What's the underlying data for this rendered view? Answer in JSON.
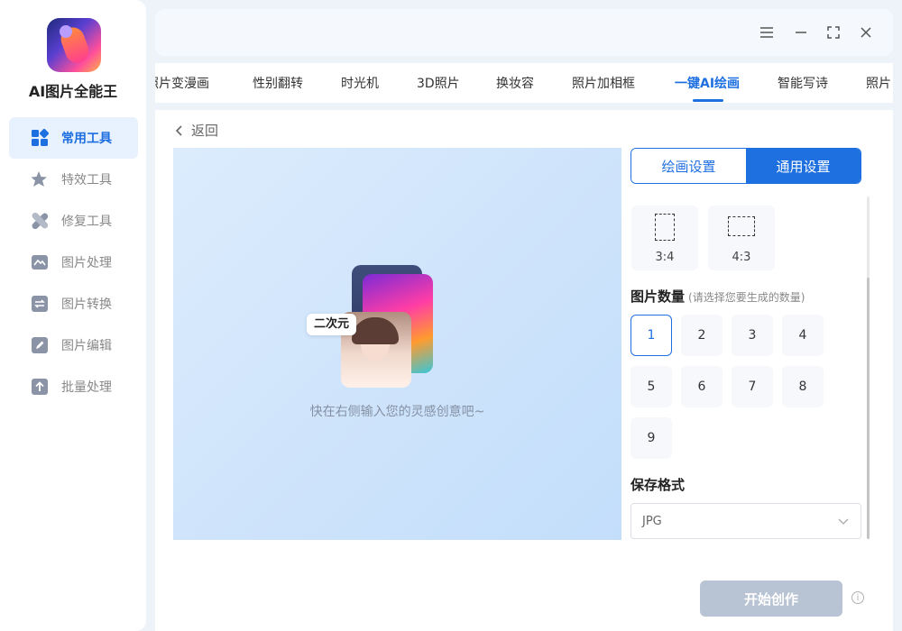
{
  "app": {
    "name": "AI图片全能王"
  },
  "sidebar": {
    "items": [
      {
        "label": "常用工具",
        "icon": "grid-icon",
        "active": true
      },
      {
        "label": "特效工具",
        "icon": "sparkle-icon",
        "active": false
      },
      {
        "label": "修复工具",
        "icon": "bandage-icon",
        "active": false
      },
      {
        "label": "图片处理",
        "icon": "image-icon",
        "active": false
      },
      {
        "label": "图片转换",
        "icon": "convert-icon",
        "active": false
      },
      {
        "label": "图片编辑",
        "icon": "edit-icon",
        "active": false
      },
      {
        "label": "批量处理",
        "icon": "upload-icon",
        "active": false
      }
    ]
  },
  "window_controls": [
    "menu-icon",
    "minimize-icon",
    "maximize-icon",
    "close-icon"
  ],
  "tabs": [
    {
      "label": "照片变漫画",
      "active": false
    },
    {
      "label": "性别翻转",
      "active": false
    },
    {
      "label": "时光机",
      "active": false
    },
    {
      "label": "3D照片",
      "active": false
    },
    {
      "label": "换妆容",
      "active": false
    },
    {
      "label": "照片加相框",
      "active": false
    },
    {
      "label": "一键AI绘画",
      "active": true
    },
    {
      "label": "智能写诗",
      "active": false
    },
    {
      "label": "照片",
      "active": false
    }
  ],
  "main": {
    "back_label": "返回",
    "preview": {
      "tag_label": "二次元",
      "hint": "快在右侧输入您的灵感创意吧~"
    },
    "settings": {
      "segments": [
        {
          "label": "绘画设置",
          "active": false
        },
        {
          "label": "通用设置",
          "active": true
        }
      ],
      "ratios": [
        {
          "label": "3:4"
        },
        {
          "label": "4:3"
        }
      ],
      "count_title": "图片数量",
      "count_subtitle": "(请选择您要生成的数量)",
      "counts": [
        "1",
        "2",
        "3",
        "4",
        "5",
        "6",
        "7",
        "8",
        "9"
      ],
      "selected_count": "1",
      "format_title": "保存格式",
      "format_value": "JPG",
      "start_label": "开始创作",
      "info_glyph": "i"
    }
  },
  "colors": {
    "accent": "#1e6fe0",
    "sidebar_active_bg": "#e8f1fe",
    "start_disabled": "#b8c3d3"
  }
}
